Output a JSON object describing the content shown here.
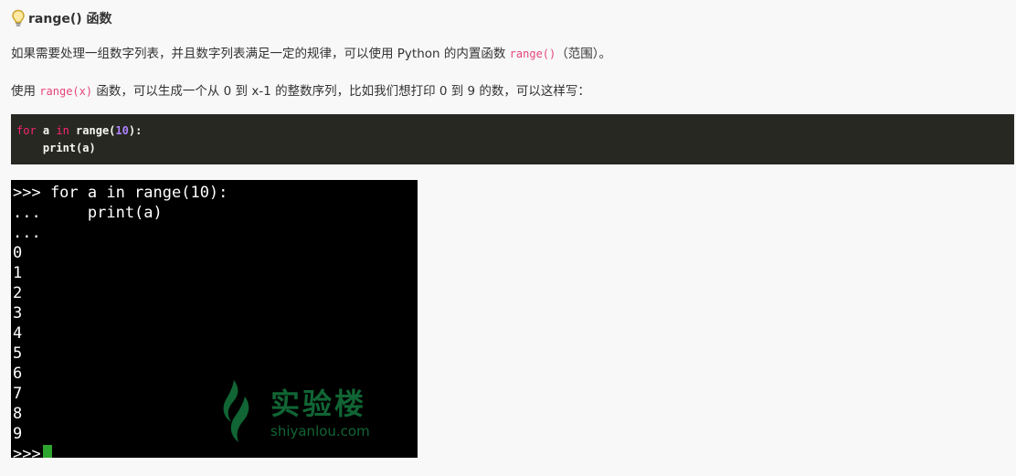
{
  "section": {
    "title": "range() 函数",
    "icon": "lightbulb-icon"
  },
  "paragraphs": {
    "p1": {
      "before": "如果需要处理一组数字列表，并且数字列表满足一定的规律，可以使用 Python 的内置函数 ",
      "code": "range()",
      "after": "（范围）。"
    },
    "p2": {
      "before": "使用 ",
      "code": "range(x)",
      "after": " 函数，可以生成一个从 0 到 x-1 的整数序列，比如我们想打印 0 到 9 的数，可以这样写："
    }
  },
  "code_block": {
    "line1": {
      "kw_for": "for",
      "var": " a ",
      "kw_in": "in",
      "func": " range(",
      "num": "10",
      "end": "):"
    },
    "line2": "    print(a)"
  },
  "terminal": {
    "lines": [
      ">>> for a in range(10):",
      "...     print(a)",
      "...",
      "0",
      "1",
      "2",
      "3",
      "4",
      "5",
      "6",
      "7",
      "8",
      "9"
    ],
    "prompt": ">>>",
    "watermark_cn": "实验楼",
    "watermark_en": "shiyanlou.com"
  },
  "colors": {
    "inline_code": "#e5457b",
    "code_bg": "#272822",
    "terminal_bg": "#000000",
    "cursor": "#2ea52e",
    "watermark": "#13703a"
  }
}
